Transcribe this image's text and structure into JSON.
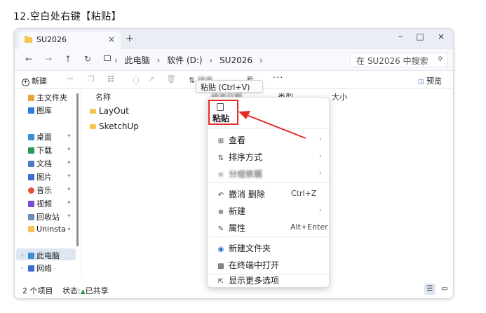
{
  "caption": "12.空白处右键【粘贴】",
  "window": {
    "tab_title": "SU2026",
    "tab_close": "×",
    "new_tab": "+",
    "minimize": "–",
    "maximize": "□",
    "close": "×"
  },
  "address": {
    "back": "←",
    "forward": "→",
    "up": "↑",
    "refresh": "↻",
    "crumbs": [
      "此电脑",
      "软件 (D:)",
      "SU2026"
    ],
    "separator": "›",
    "search_placeholder": "在 SU2026 中搜索",
    "search_icon": "search-icon"
  },
  "toolbar": {
    "new_label": "新建",
    "more": "···",
    "preview_label": "预览",
    "partial_sort": "排序",
    "partial_view": "看"
  },
  "sidebar": {
    "items": [
      {
        "label": "主文件夹",
        "icon": "home-icon",
        "color": "#e8a33a",
        "pinned": false
      },
      {
        "label": "图库",
        "icon": "gallery-icon",
        "color": "#2f7fd8",
        "pinned": false
      },
      {
        "label": "桌面",
        "icon": "desktop-icon",
        "color": "#3a8fd9",
        "pinned": true
      },
      {
        "label": "下载",
        "icon": "download-icon",
        "color": "#2a9a57",
        "pinned": true
      },
      {
        "label": "文档",
        "icon": "document-icon",
        "color": "#4d7cc4",
        "pinned": true
      },
      {
        "label": "图片",
        "icon": "picture-icon",
        "color": "#3d6fd1",
        "pinned": true
      },
      {
        "label": "音乐",
        "icon": "music-icon",
        "color": "#e2533a",
        "pinned": true
      },
      {
        "label": "视频",
        "icon": "video-icon",
        "color": "#7a4ccf",
        "pinned": true
      },
      {
        "label": "回收站",
        "icon": "recycle-bin-icon",
        "color": "#6f8fb8",
        "pinned": true
      },
      {
        "label": "Uninsta",
        "icon": "folder-icon",
        "color": "#f6c64f",
        "pinned": true
      }
    ],
    "this_pc": "此电脑",
    "network": "网络"
  },
  "files": {
    "columns": {
      "name": "名称",
      "modified": "修改日期",
      "type": "类型",
      "size": "大小"
    },
    "rows": [
      {
        "name": "LayOut"
      },
      {
        "name": "SketchUp"
      }
    ]
  },
  "status": {
    "count": "2 个项目",
    "state_label": "状态:",
    "state_value": "已共享"
  },
  "context_menu": {
    "paste_label": "粘贴",
    "items": [
      {
        "icon": "view-icon",
        "label": "查看",
        "submenu": true
      },
      {
        "icon": "sort-icon",
        "label": "排序方式",
        "submenu": true
      },
      {
        "icon": "group-icon",
        "label": "分组依据",
        "submenu": true
      },
      {
        "icon": "undo-icon",
        "label": "撤消 删除",
        "shortcut": "Ctrl+Z"
      },
      {
        "icon": "new-icon",
        "label": "新建",
        "submenu": true
      },
      {
        "icon": "properties-icon",
        "label": "属性",
        "shortcut": "Alt+Enter"
      },
      {
        "icon": "new-folder-icon",
        "label": "新建文件夹"
      },
      {
        "icon": "terminal-icon",
        "label": "在终端中打开"
      },
      {
        "icon": "more-options-icon",
        "label": "显示更多选项"
      }
    ]
  },
  "tooltip": "粘贴 (Ctrl+V)",
  "colors": {
    "annotation_red": "#e32b25",
    "selection": "#dde6f1"
  }
}
